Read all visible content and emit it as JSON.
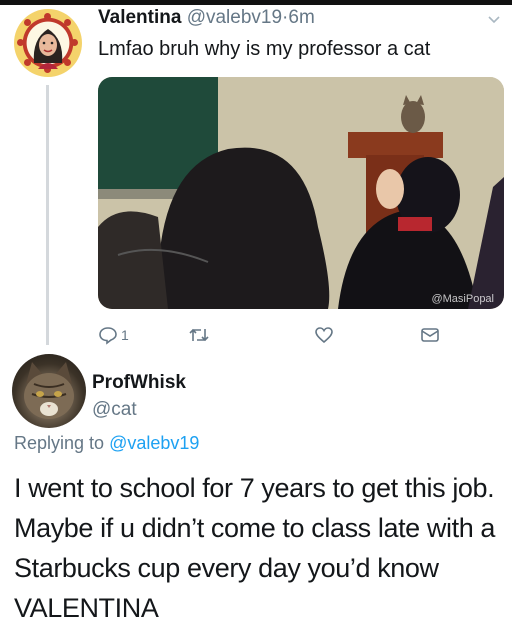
{
  "tweet": {
    "display_name": "Valentina",
    "handle": "@valebv19",
    "separator": "·",
    "time": "6m",
    "text": "Lmfao bruh why is my professor a cat",
    "photo_watermark": "@MasiPopal",
    "actions": {
      "reply_icon": "reply-icon",
      "reply_count": "1",
      "retweet_icon": "retweet-icon",
      "like_icon": "heart-icon",
      "dm_icon": "mail-icon"
    }
  },
  "reply": {
    "display_name": "ProfWhisk",
    "handle": "@cat",
    "replying_label": "Replying to",
    "replying_handle": "@valebv19",
    "text": "I went to school for 7 years to get this job. Maybe if u didn’t come to class late with a Starbucks cup every day you’d know VALENTINA"
  },
  "colors": {
    "text": "#14171a",
    "muted": "#657786",
    "link": "#1da1f2",
    "thread_line": "#d4d8dc"
  }
}
